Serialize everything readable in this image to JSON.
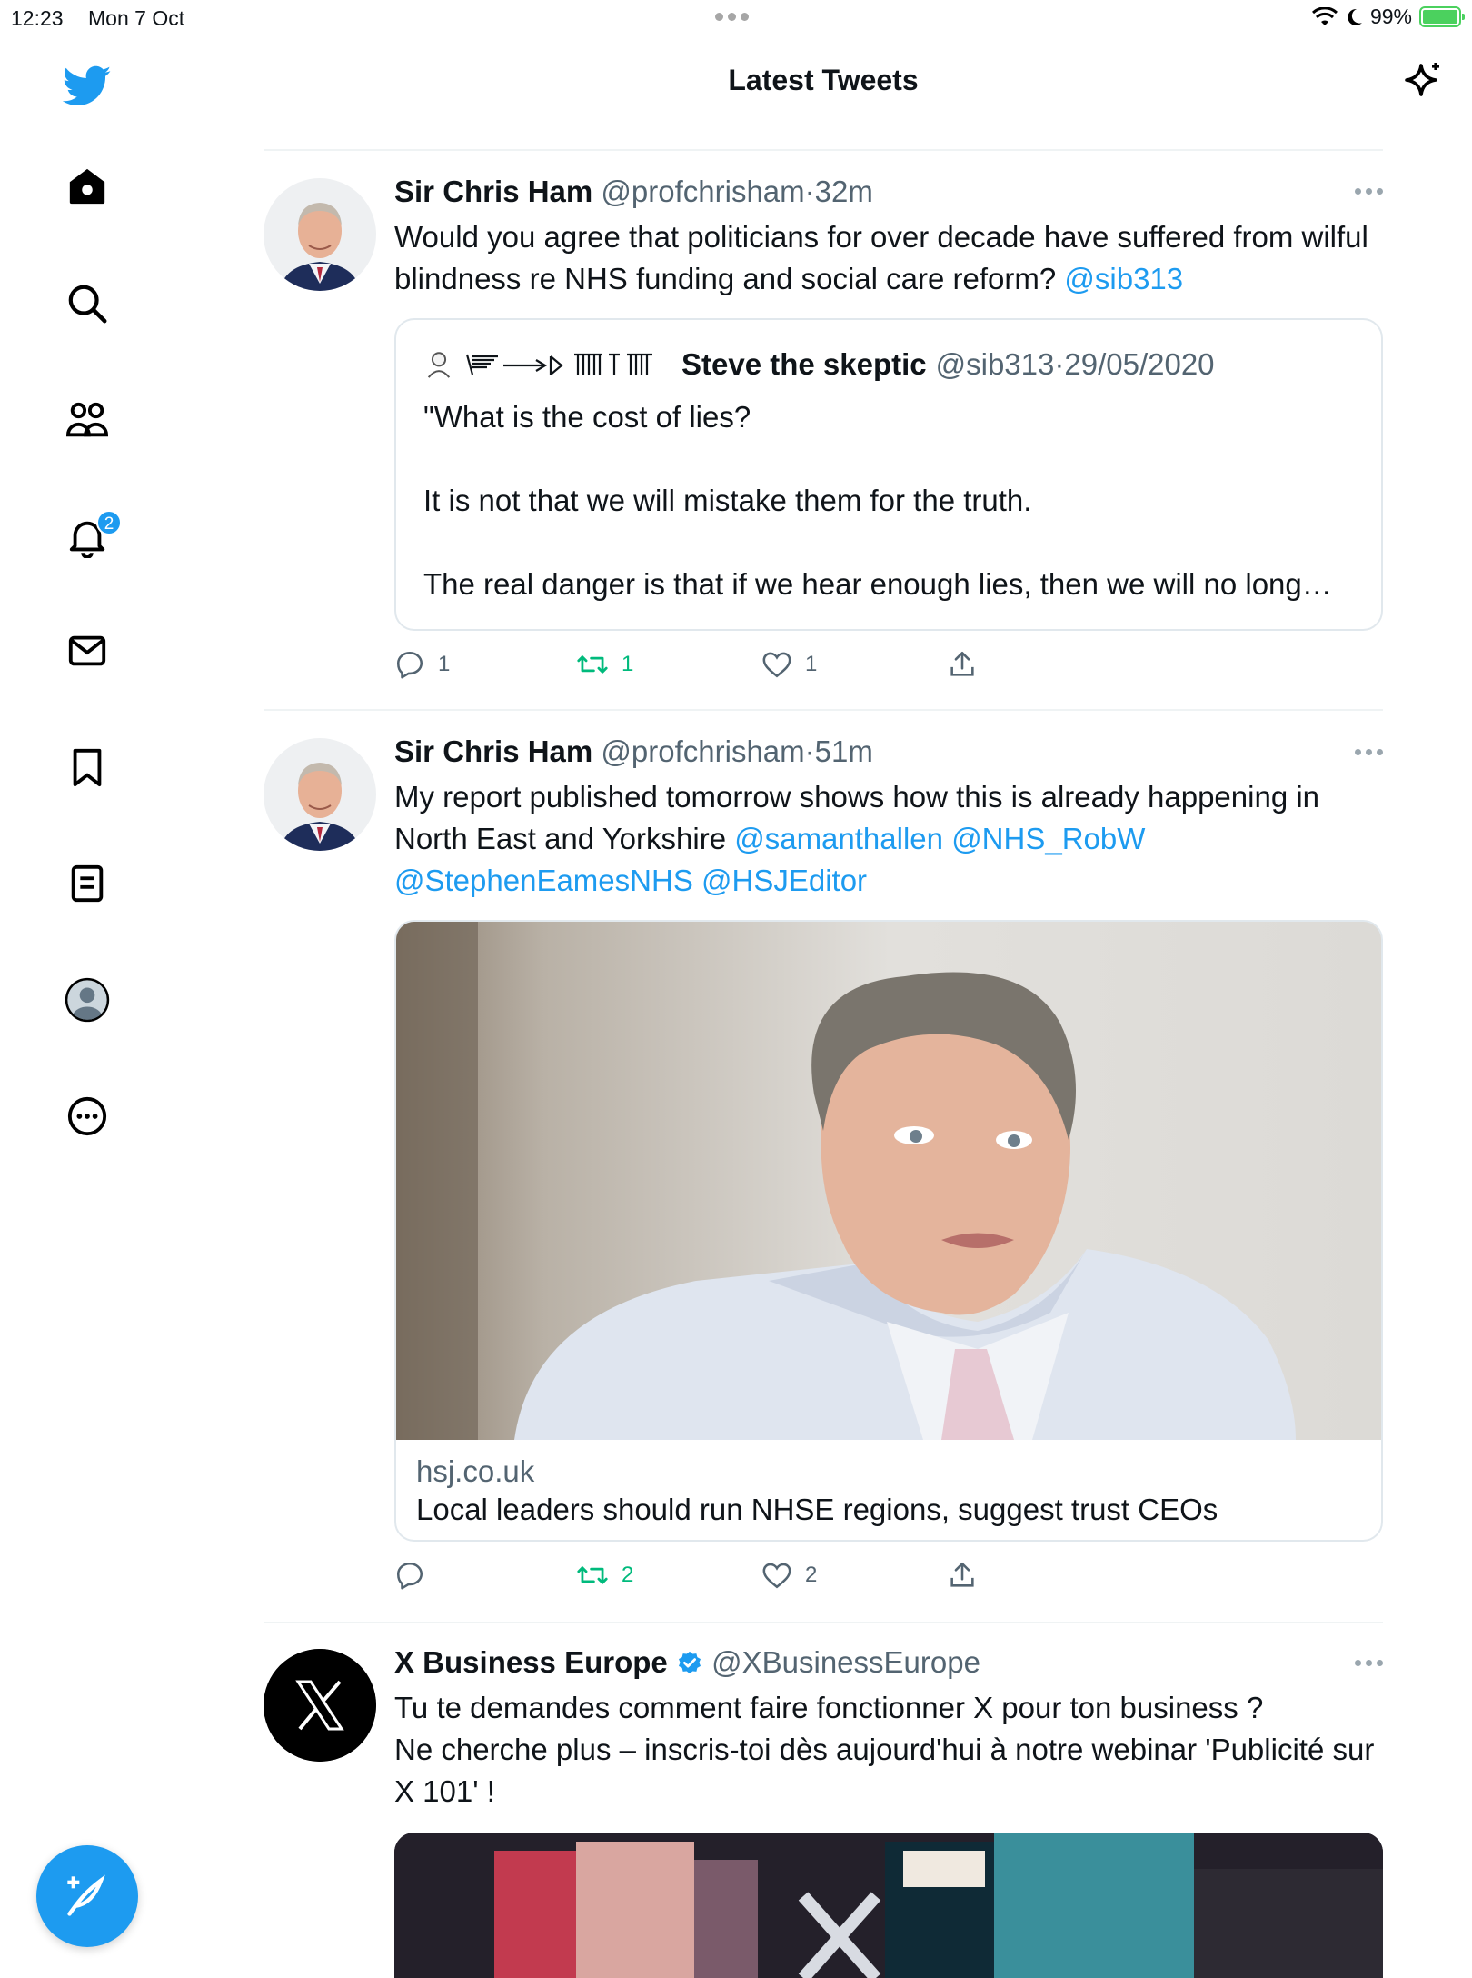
{
  "status_bar": {
    "time": "12:23",
    "date": "Mon 7 Oct",
    "battery": "99%"
  },
  "header": {
    "title": "Latest Tweets"
  },
  "sidebar": {
    "notification_badge": "2"
  },
  "tweets": [
    {
      "name": "Sir Chris Ham",
      "handle": "@profchrisham",
      "time": "32m",
      "text": "Would you agree that politicians for over  decade have suffered from wilful blindness re NHS funding and social care reform?",
      "mentions": [
        "@sib313"
      ],
      "quote": {
        "name": "Steve the skeptic",
        "handle": "@sib313",
        "date": "29/05/2020",
        "line1": "\"What is the cost of lies?",
        "line2": "It is not that we will mistake them for the truth.",
        "line3": "The real danger is that if we hear enough lies, then we will no long…"
      },
      "replies": "1",
      "retweets": "1",
      "likes": "1"
    },
    {
      "name": "Sir Chris Ham",
      "handle": "@profchrisham",
      "time": "51m",
      "text": "My report published tomorrow shows how this is already happening in North East and Yorkshire",
      "mentions": [
        "@samanthallen",
        "@NHS_RobW",
        "@StephenEamesNHS",
        "@HSJEditor"
      ],
      "card": {
        "domain": "hsj.co.uk",
        "title": "Local leaders should run NHSE regions, suggest trust CEOs"
      },
      "replies": "",
      "retweets": "2",
      "likes": "2"
    },
    {
      "name": "X Business Europe",
      "handle": "@XBusinessEurope",
      "line1": "Tu te demandes comment faire fonctionner X pour ton business ?",
      "line2": "Ne cherche plus – inscris-toi dès aujourd'hui à notre webinar 'Publicité sur X 101' !"
    }
  ],
  "colors": {
    "accent": "#1d9bf0",
    "retweet": "#00ba7c",
    "secondary_text": "#536471"
  }
}
